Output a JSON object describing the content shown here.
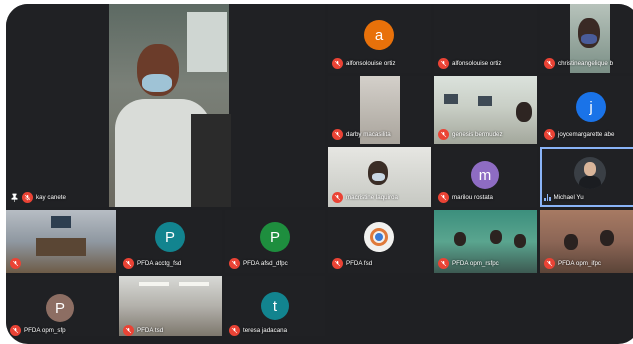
{
  "meeting": {
    "tiles": {
      "kay": {
        "name": "kay canete"
      },
      "alfonso1": {
        "name": "alfonsolouise ortiz",
        "initial": "a"
      },
      "alfonso2": {
        "name": "alfonsolouise ortiz"
      },
      "christine": {
        "name": "christineangelique b"
      },
      "darby": {
        "name": "darby macasilita"
      },
      "genesis": {
        "name": "genesis bermudez"
      },
      "joyce": {
        "name": "joycemargarette abe",
        "initial": "j"
      },
      "macristine": {
        "name": "macristine laquiroa"
      },
      "marilou": {
        "name": "marilou rostata",
        "initial": "m"
      },
      "michael": {
        "name": "Michael Yu"
      },
      "pfda_meeting": {
        "name": ""
      },
      "acctg": {
        "name": "PFDA acctg_fsd",
        "initial": "P"
      },
      "afsd": {
        "name": "PFDA afsd_dfpc",
        "initial": "P"
      },
      "fsd": {
        "name": "PFDA fsd"
      },
      "opm": {
        "name": "PFDA opm_rsfpc"
      },
      "opm_ifpc": {
        "name": "PFDA opm_ifpc"
      },
      "opm_sfp": {
        "name": "PFDA opm_sfp",
        "initial": "P"
      },
      "pfda_tsd": {
        "name": "PFDA tsd"
      },
      "teresa": {
        "name": "teresa jadacana",
        "initial": "t"
      }
    },
    "colors": {
      "orange": "#e8710a",
      "blue": "#1a73e8",
      "purple": "#8e6cc3",
      "teal": "#12848f",
      "green": "#1e8e3e",
      "brown": "#8d6e63",
      "mute_red": "#ea4335"
    }
  }
}
